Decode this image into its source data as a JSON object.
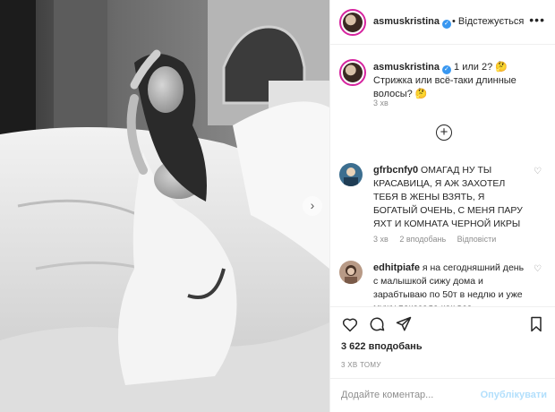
{
  "post": {
    "author": "asmuskristina",
    "follow_state": "• Відстежується",
    "more_glyph": "•••",
    "photo_alt": "",
    "next_arrow_glyph": "›"
  },
  "caption": {
    "username": "asmuskristina",
    "text": "1 или 2? 🤔 Стрижка или всё-таки длинные волосы? 🤔",
    "time": "3 хв"
  },
  "load_more_glyph": "+",
  "comments": [
    {
      "username": "gfrbcnfy0",
      "text": "ОМАГАД НУ ТЫ КРАСАВИЦА, Я АЖ ЗАХОТЕЛ ТЕБЯ В ЖЕНЫ ВЗЯТЬ, Я БОГАТЫЙ ОЧЕНЬ, С МЕНЯ ПАРУ ЯХТ И КОМНАТА ЧЕРНОЙ ИКРЫ",
      "time": "3 хв",
      "likes": "2 вподобань",
      "reply": "Відповісти"
    },
    {
      "username": "edhitpiafe",
      "text": "я на сегодняшний день с малышкой сижу дома и зарабтываю по 50т в недлю и уже мужу показала как все"
    }
  ],
  "stats": {
    "likes": "3 622 вподобань",
    "time": "3 ХВ ТОМУ"
  },
  "add_comment": {
    "placeholder": "Додайте коментар...",
    "publish_label": "Опублікувати"
  },
  "colors": {
    "accent_blue": "#3897f0",
    "publish_disabled": "#b2dffc",
    "story_ring": "#d6249f",
    "muted_text": "#8e8e8e"
  },
  "icons": [
    "heart-icon",
    "comment-icon",
    "share-icon",
    "bookmark-icon",
    "add-circle-icon",
    "verified-icon",
    "more-icon",
    "chevron-right-icon"
  ]
}
